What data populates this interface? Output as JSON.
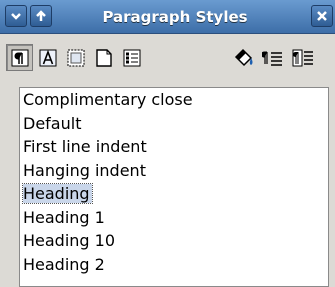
{
  "window": {
    "title": "Paragraph Styles"
  },
  "titlebar": {
    "menu_icon": "chevron-down-icon",
    "shade_icon": "arrow-up-icon",
    "close_icon": "close-icon"
  },
  "toolbar": {
    "tools": [
      {
        "name": "paragraph-styles",
        "icon": "pilcrow-icon",
        "active": true
      },
      {
        "name": "character-styles",
        "icon": "character-a-icon"
      },
      {
        "name": "frame-styles",
        "icon": "frame-icon"
      },
      {
        "name": "page-styles",
        "icon": "page-icon"
      },
      {
        "name": "list-styles",
        "icon": "list-icon"
      },
      {
        "name": "fill-format-mode",
        "icon": "paint-bucket-icon"
      },
      {
        "name": "new-style-from-selection",
        "icon": "new-style-icon"
      },
      {
        "name": "update-style",
        "icon": "update-style-icon"
      }
    ]
  },
  "styles": {
    "items": [
      "Complimentary close",
      "Default",
      "First line indent",
      "Hanging indent",
      "Heading",
      "Heading 1",
      "Heading 10",
      "Heading 2"
    ],
    "selected": "Heading"
  },
  "colors": {
    "titlebar": "#3d6ea8",
    "selection": "#c9d6ea"
  }
}
